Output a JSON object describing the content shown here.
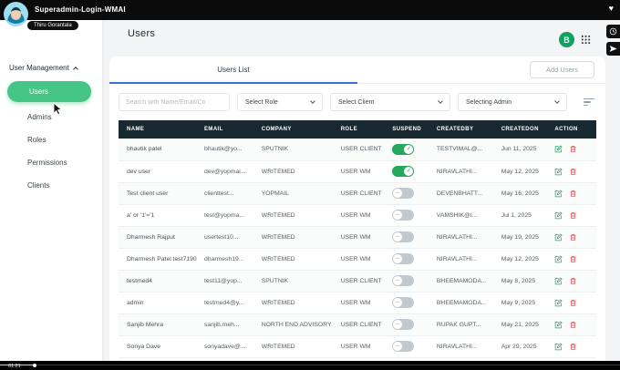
{
  "topbar": {
    "title": "Superadmin-Login-WMAI",
    "badge": "Thiru Gorantala"
  },
  "header": {
    "page_title": "Users",
    "avatar_initial": "B"
  },
  "sidebar": {
    "section": "User Management",
    "items": [
      {
        "label": "Users",
        "active": true
      },
      {
        "label": "Admins",
        "active": false
      },
      {
        "label": "Roles",
        "active": false
      },
      {
        "label": "Permissions",
        "active": false
      },
      {
        "label": "Clients",
        "active": false
      }
    ]
  },
  "tabs": {
    "users_list_label": "Users List",
    "add_users_label": "Add Users"
  },
  "filters": {
    "search_placeholder": "Search with Name/Email/Co",
    "role_label": "Select Role",
    "client_label": "Select Client",
    "admin_label": "Selecting Admin"
  },
  "table": {
    "columns": [
      "NAME",
      "EMAIL",
      "COMPANY",
      "ROLE",
      "SUSPEND",
      "CREATEDBY",
      "CREATEDON",
      "ACTION"
    ],
    "rows": [
      {
        "name": "bhautik patel",
        "email": "bhautik@yo...",
        "company": "SPUTNIK",
        "role": "USER CLIENT",
        "suspended": true,
        "createdby": "TESTVIMAL@...",
        "createdon": "Jun 11, 2025"
      },
      {
        "name": "dev user",
        "email": "dev@yopmai...",
        "company": "WRITEMED",
        "role": "USER WM",
        "suspended": true,
        "createdby": "NIRAVLATHI...",
        "createdon": "May 12, 2025"
      },
      {
        "name": "Test client user",
        "email": "clienttest...",
        "company": "YOPMAIL",
        "role": "USER CLIENT",
        "suspended": false,
        "createdby": "DEVENBHATT...",
        "createdon": "May 16, 2025"
      },
      {
        "name": "a' or '1'='1",
        "email": "test@yopma...",
        "company": "WRITEMED",
        "role": "USER WM",
        "suspended": false,
        "createdby": "VAMSHIK@I...",
        "createdon": "Jul 1, 2025"
      },
      {
        "name": "Dharmesh Rajput",
        "email": "usertest10...",
        "company": "WRITEMED",
        "role": "USER WM",
        "suspended": false,
        "createdby": "NIRAVLATHI...",
        "createdon": "May 19, 2025"
      },
      {
        "name": "Dharmesh Patel test7190",
        "email": "dharmesh19...",
        "company": "WRITEMED",
        "role": "USER WM",
        "suspended": false,
        "createdby": "NIRAVLATHI...",
        "createdon": "May 12, 2025"
      },
      {
        "name": "testmed4",
        "email": "test11@yop...",
        "company": "SPUTNIK",
        "role": "USER CLIENT",
        "suspended": false,
        "createdby": "BHEEMAMODA...",
        "createdon": "May 8, 2025"
      },
      {
        "name": "admin",
        "email": "testmed4@y...",
        "company": "WRITEMED",
        "role": "USER WM",
        "suspended": false,
        "createdby": "BHEEMAMODA...",
        "createdon": "May 9, 2025"
      },
      {
        "name": "Sanjib Mehra",
        "email": "sanjib.meh...",
        "company": "NORTH END ADVISORY",
        "role": "USER CLIENT",
        "suspended": false,
        "createdby": "RUPAK GUPT...",
        "createdon": "May 21, 2025"
      },
      {
        "name": "Sonya Dave",
        "email": "sonyadave@...",
        "company": "WRITEMED",
        "role": "USER WM",
        "suspended": false,
        "createdby": "NIRAVLATHI...",
        "createdon": "Apr 29, 2025"
      }
    ]
  },
  "icons": {
    "heart": "♥",
    "toggle_on": "✓",
    "toggle_off": "–"
  },
  "player": {
    "time": "01:21"
  },
  "colors": {
    "accent_green": "#23a85c",
    "tab_blue": "#3a6fd8",
    "header_dark": "#182830",
    "sidebar_active": "#45c687"
  }
}
